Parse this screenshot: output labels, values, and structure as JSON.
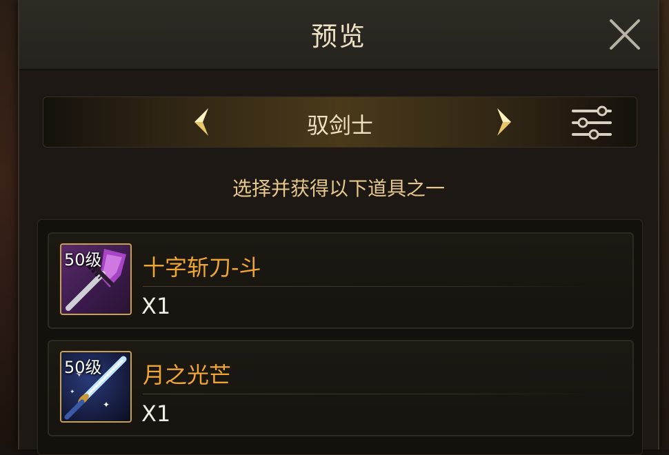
{
  "header": {
    "title": "预览"
  },
  "selector": {
    "class_name": "驭剑士"
  },
  "instruction": "选择并获得以下道具之一",
  "items": [
    {
      "level": "50级",
      "name": "十字斩刀-斗",
      "quantity": "X1",
      "icon": "purple-sword-icon"
    },
    {
      "level": "50级",
      "name": "月之光芒",
      "quantity": "X1",
      "icon": "moonlight-sword-icon"
    }
  ],
  "colors": {
    "item_name": "#f0a634",
    "title": "#efe2c4",
    "instruction": "#e5c88e",
    "icon_border": "#c9a24a"
  }
}
